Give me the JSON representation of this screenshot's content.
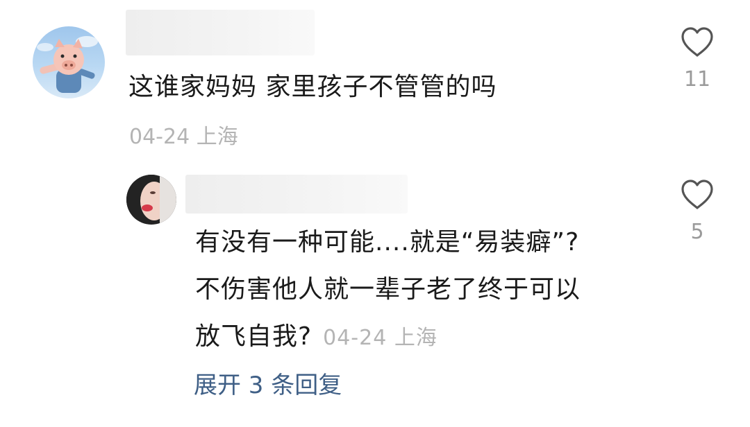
{
  "comment": {
    "text": "这谁家妈妈 家里孩子不管管的吗",
    "meta": "04-24 上海",
    "likes": "11"
  },
  "reply": {
    "lines": [
      "有没有一种可能....就是“易装癖”?",
      "不伤害他人就一辈子老了终于可以",
      "放飞自我?"
    ],
    "meta": "04-24 上海",
    "likes": "5"
  },
  "expand_label": "展开 3 条回复",
  "colors": {
    "text": "#1a1a1a",
    "meta": "#b4b4b4",
    "link": "#3f5f86",
    "icon": "#555555"
  }
}
